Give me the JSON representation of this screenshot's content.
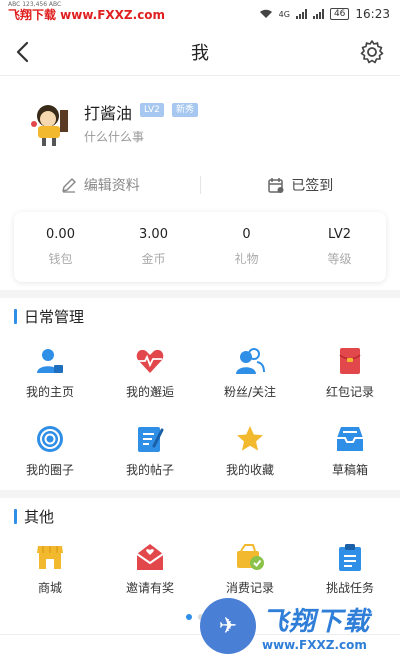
{
  "status_bar": {
    "watermark": "飞翔下载 www.FXXZ.com",
    "tiny_text": "ABC 123,456 ABC",
    "network": "4G",
    "battery": "46",
    "time": "16:23"
  },
  "header": {
    "title": "我"
  },
  "profile": {
    "name": "打酱油",
    "level_badge": "LV2",
    "role_badge": "新秀",
    "bio": "什么什么事"
  },
  "actions": {
    "edit_label": "编辑资料",
    "signin_label": "已签到"
  },
  "stats": [
    {
      "value": "0.00",
      "label": "钱包"
    },
    {
      "value": "3.00",
      "label": "金币"
    },
    {
      "value": "0",
      "label": "礼物"
    },
    {
      "value": "LV2",
      "label": "等级"
    }
  ],
  "daily": {
    "title": "日常管理",
    "items": [
      {
        "label": "我的主页",
        "icon": "user-home-icon"
      },
      {
        "label": "我的邂逅",
        "icon": "heart-pulse-icon"
      },
      {
        "label": "粉丝/关注",
        "icon": "fans-icon"
      },
      {
        "label": "红包记录",
        "icon": "red-envelope-icon"
      },
      {
        "label": "我的圈子",
        "icon": "circle-target-icon"
      },
      {
        "label": "我的帖子",
        "icon": "post-edit-icon"
      },
      {
        "label": "我的收藏",
        "icon": "star-icon"
      },
      {
        "label": "草稿箱",
        "icon": "drafts-tray-icon"
      }
    ]
  },
  "other": {
    "title": "其他",
    "items": [
      {
        "label": "商城",
        "icon": "store-icon"
      },
      {
        "label": "邀请有奖",
        "icon": "invite-mail-icon"
      },
      {
        "label": "消费记录",
        "icon": "consume-record-icon"
      },
      {
        "label": "挑战任务",
        "icon": "task-clipboard-icon"
      }
    ]
  },
  "overlay_watermark": {
    "text": "飞翔下载",
    "url": "www.FXXZ.com"
  },
  "colors": {
    "blue": "#2f8ee6",
    "red": "#e2474b",
    "yellow": "#f3b92e"
  }
}
